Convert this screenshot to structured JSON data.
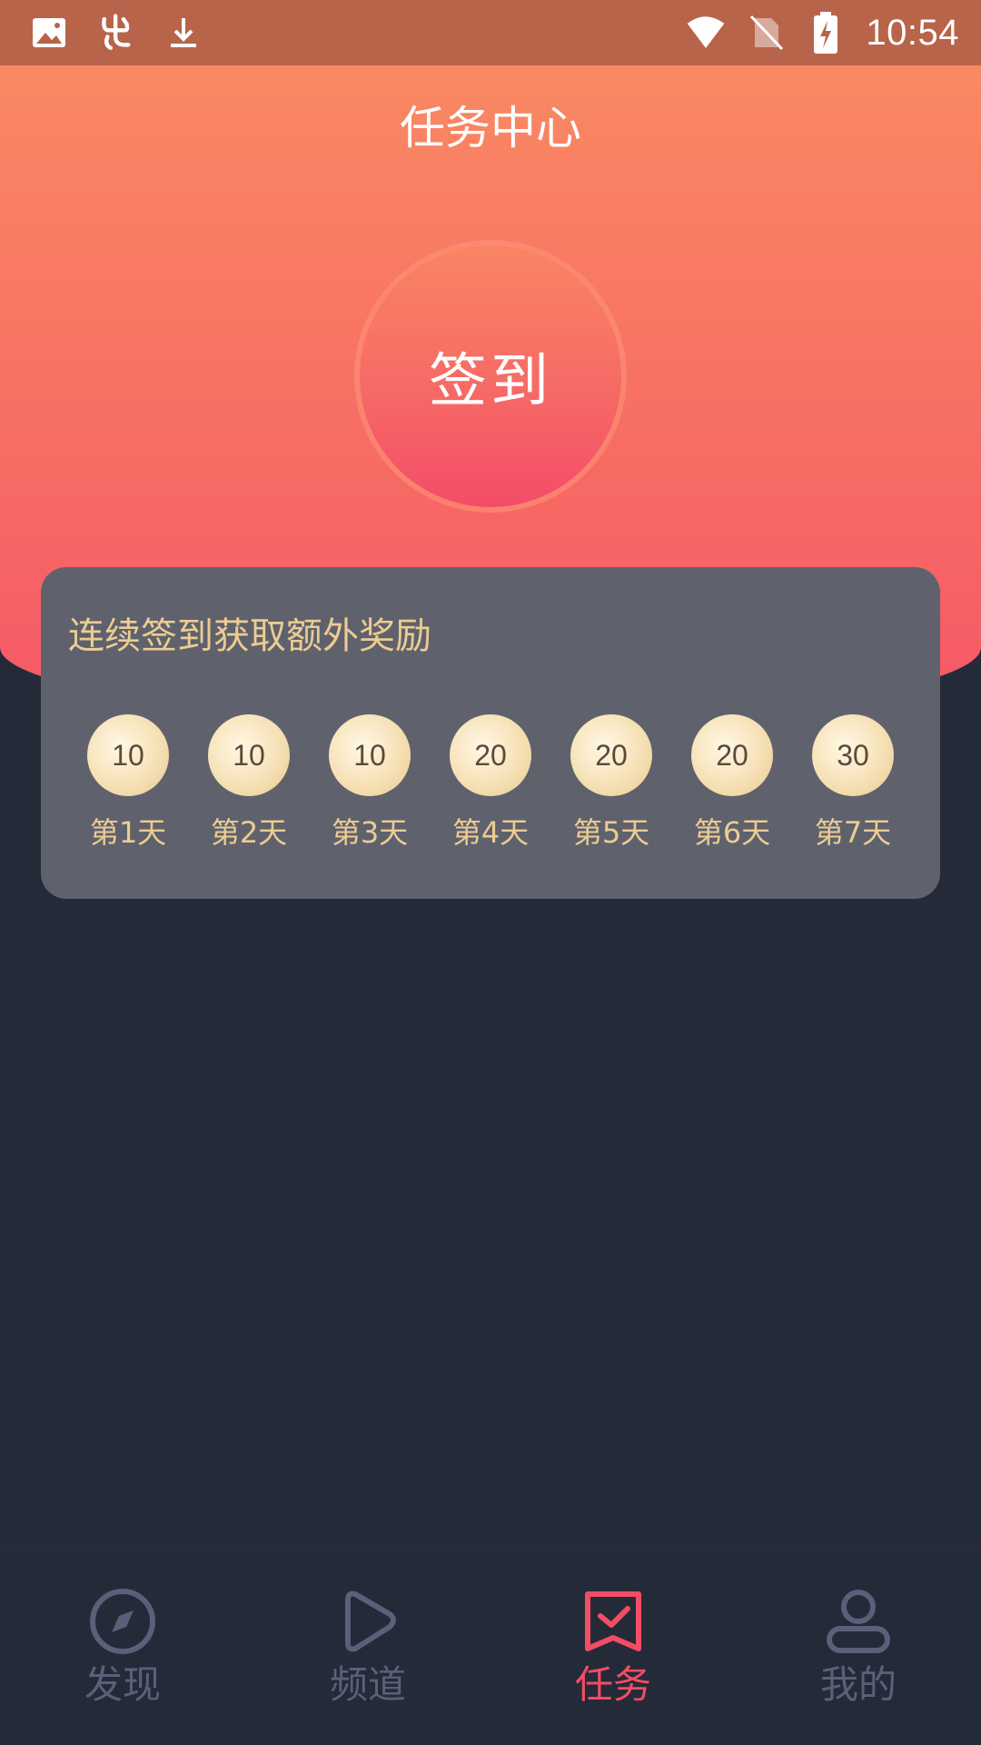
{
  "status_bar": {
    "time": "10:54",
    "left_icons": [
      "image-icon",
      "app-logo-icon",
      "download-icon"
    ],
    "right_icons": [
      "wifi-icon",
      "no-sim-icon",
      "battery-charging-icon"
    ]
  },
  "header": {
    "title": "任务中心"
  },
  "checkin": {
    "button_label": "签到"
  },
  "rewards": {
    "title": "连续签到获取额外奖励",
    "days": [
      {
        "amount": "10",
        "label": "第1天"
      },
      {
        "amount": "10",
        "label": "第2天"
      },
      {
        "amount": "10",
        "label": "第3天"
      },
      {
        "amount": "20",
        "label": "第4天"
      },
      {
        "amount": "20",
        "label": "第5天"
      },
      {
        "amount": "20",
        "label": "第6天"
      },
      {
        "amount": "30",
        "label": "第7天"
      }
    ]
  },
  "bottom_nav": {
    "items": [
      {
        "label": "发现",
        "icon": "compass-icon",
        "active": false
      },
      {
        "label": "频道",
        "icon": "play-icon",
        "active": false
      },
      {
        "label": "任务",
        "icon": "task-check-icon",
        "active": true
      },
      {
        "label": "我的",
        "icon": "user-icon",
        "active": false
      }
    ]
  },
  "colors": {
    "accent": "#f24d64",
    "gold_text": "#eccc93",
    "nav_inactive": "#5a6079",
    "background": "#252a38"
  }
}
